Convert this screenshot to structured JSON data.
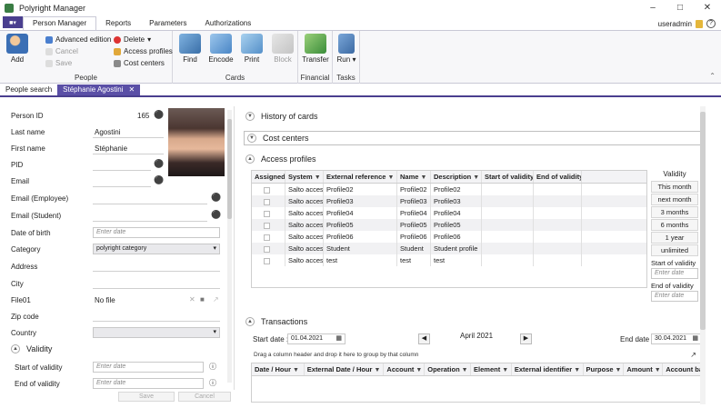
{
  "window": {
    "title": "Polyright Manager"
  },
  "ribbon_tabs": [
    "Person Manager",
    "Reports",
    "Parameters",
    "Authorizations"
  ],
  "user": {
    "name": "useradmin"
  },
  "ribbon": {
    "people": {
      "label": "People",
      "add": "Add",
      "advanced_edition": "Advanced edition",
      "cancel": "Cancel",
      "save": "Save",
      "delete": "Delete",
      "access_profiles": "Access profiles",
      "cost_centers": "Cost centers"
    },
    "cards": {
      "label": "Cards",
      "find": "Find",
      "encode": "Encode",
      "print": "Print",
      "block": "Block"
    },
    "financial": {
      "label": "Financial",
      "transfer": "Transfer"
    },
    "tasks": {
      "label": "Tasks",
      "run": "Run"
    }
  },
  "doc_tabs": [
    {
      "label": "People search"
    },
    {
      "label": "Stéphanie Agostini"
    }
  ],
  "person": {
    "labels": {
      "person_id": "Person ID",
      "last_name": "Last name",
      "first_name": "First name",
      "pid": "PID",
      "email": "Email",
      "email_employee": "Email (Employee)",
      "email_student": "Email (Student)",
      "date_of_birth": "Date of birth",
      "category": "Category",
      "address": "Address",
      "city": "City",
      "file01": "File01",
      "zip_code": "Zip code",
      "country": "Country",
      "validity": "Validity",
      "start_of_validity": "Start of validity",
      "end_of_validity": "End of validity"
    },
    "values": {
      "person_id": "165",
      "last_name": "Agostini",
      "first_name": "Stéphanie",
      "date_of_birth_placeholder": "Enter date",
      "category": "polyright category",
      "file01": "No file",
      "start_placeholder": "Enter date",
      "end_placeholder": "Enter date"
    },
    "buttons": {
      "save": "Save",
      "cancel": "Cancel"
    }
  },
  "sections": {
    "history_of_cards": "History of cards",
    "cost_centers": "Cost centers",
    "access_profiles": "Access profiles",
    "transactions": "Transactions"
  },
  "access_profiles": {
    "columns": [
      "Assigned",
      "System",
      "External reference",
      "Name",
      "Description",
      "Start of validity",
      "End of validity"
    ],
    "rows": [
      {
        "system": "Salto access",
        "external_reference": "Profile02",
        "name": "Profile02",
        "description": "Profile02"
      },
      {
        "system": "Salto access",
        "external_reference": "Profile03",
        "name": "Profile03",
        "description": "Profile03"
      },
      {
        "system": "Salto access",
        "external_reference": "Profile04",
        "name": "Profile04",
        "description": "Profile04"
      },
      {
        "system": "Salto access",
        "external_reference": "Profile05",
        "name": "Profile05",
        "description": "Profile05"
      },
      {
        "system": "Salto access",
        "external_reference": "Profile06",
        "name": "Profile06",
        "description": "Profile06"
      },
      {
        "system": "Salto access",
        "external_reference": "Student",
        "name": "Student",
        "description": "Student profile"
      },
      {
        "system": "Salto access",
        "external_reference": "test",
        "name": "test",
        "description": "test"
      }
    ],
    "validity": {
      "title": "Validity",
      "options": [
        "This month",
        "next month",
        "3 months",
        "6 months",
        "1 year",
        "unlimited"
      ],
      "start_label": "Start of validity",
      "end_label": "End of validity",
      "placeholder": "Enter date"
    }
  },
  "transactions": {
    "start_label": "Start date :",
    "start_value": "01.04.2021",
    "month": "April 2021",
    "end_label": "End date :",
    "end_value": "30.04.2021",
    "group_hint": "Drag a column header and drop it here to group by that column",
    "columns": [
      "Date / Hour",
      "External Date / Hour",
      "Account",
      "Operation",
      "Element",
      "External identifier",
      "Purpose",
      "Amount",
      "Account ba"
    ]
  }
}
